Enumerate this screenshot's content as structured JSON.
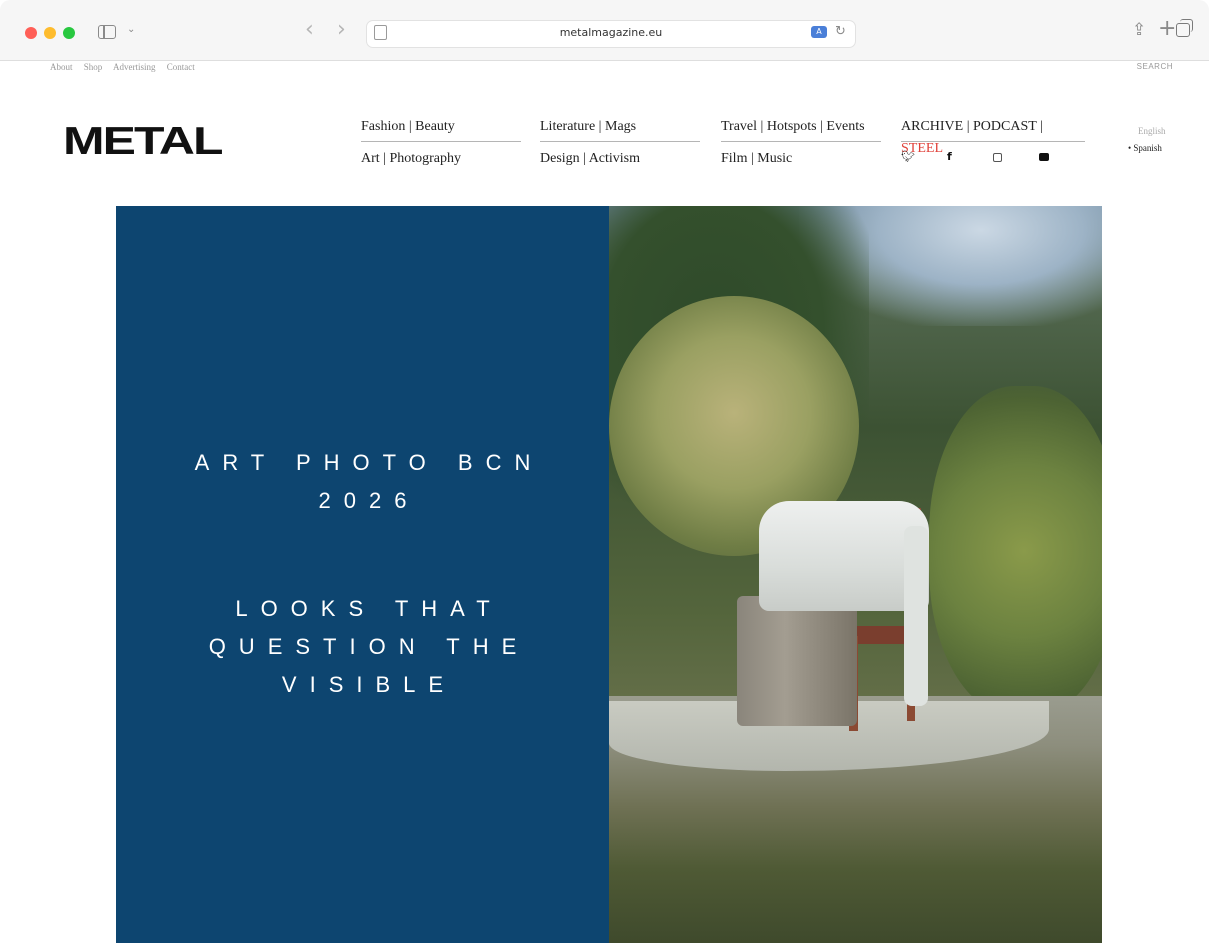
{
  "browser": {
    "url": "metalmagazine.eu",
    "icons": [
      "sidebar-icon",
      "chevron-down-icon",
      "back-icon",
      "forward-icon",
      "page-icon",
      "translate-icon",
      "reload-icon",
      "share-icon",
      "new-tab-icon",
      "tabs-icon"
    ]
  },
  "utility_nav": {
    "items": [
      "About",
      "Shop",
      "Advertising",
      "Contact"
    ],
    "search": "SEARCH"
  },
  "logo": "METAL",
  "nav": {
    "col1": [
      "Fashion | Beauty",
      "Art | Photography"
    ],
    "col2": [
      "Literature | Mags",
      "Design | Activism"
    ],
    "col3": [
      "Travel | Hotspots | Events",
      "Film | Music"
    ],
    "col4": {
      "archive": "ARCHIVE | PODCAST | ",
      "steel": "STEEL"
    },
    "socials": [
      "twitter-icon",
      "facebook-icon",
      "instagram-icon",
      "youtube-icon"
    ]
  },
  "languages": [
    "English",
    "Spanish"
  ],
  "hero": {
    "title_line1": "ART PHOTO BCN",
    "title_line2": "2026",
    "subtitle_line1": "LOOKS THAT",
    "subtitle_line2": "QUESTION THE",
    "subtitle_line3": "VISIBLE",
    "panel_color": "#0d4570"
  },
  "colors": {
    "accent_steel": "#e0413a"
  }
}
